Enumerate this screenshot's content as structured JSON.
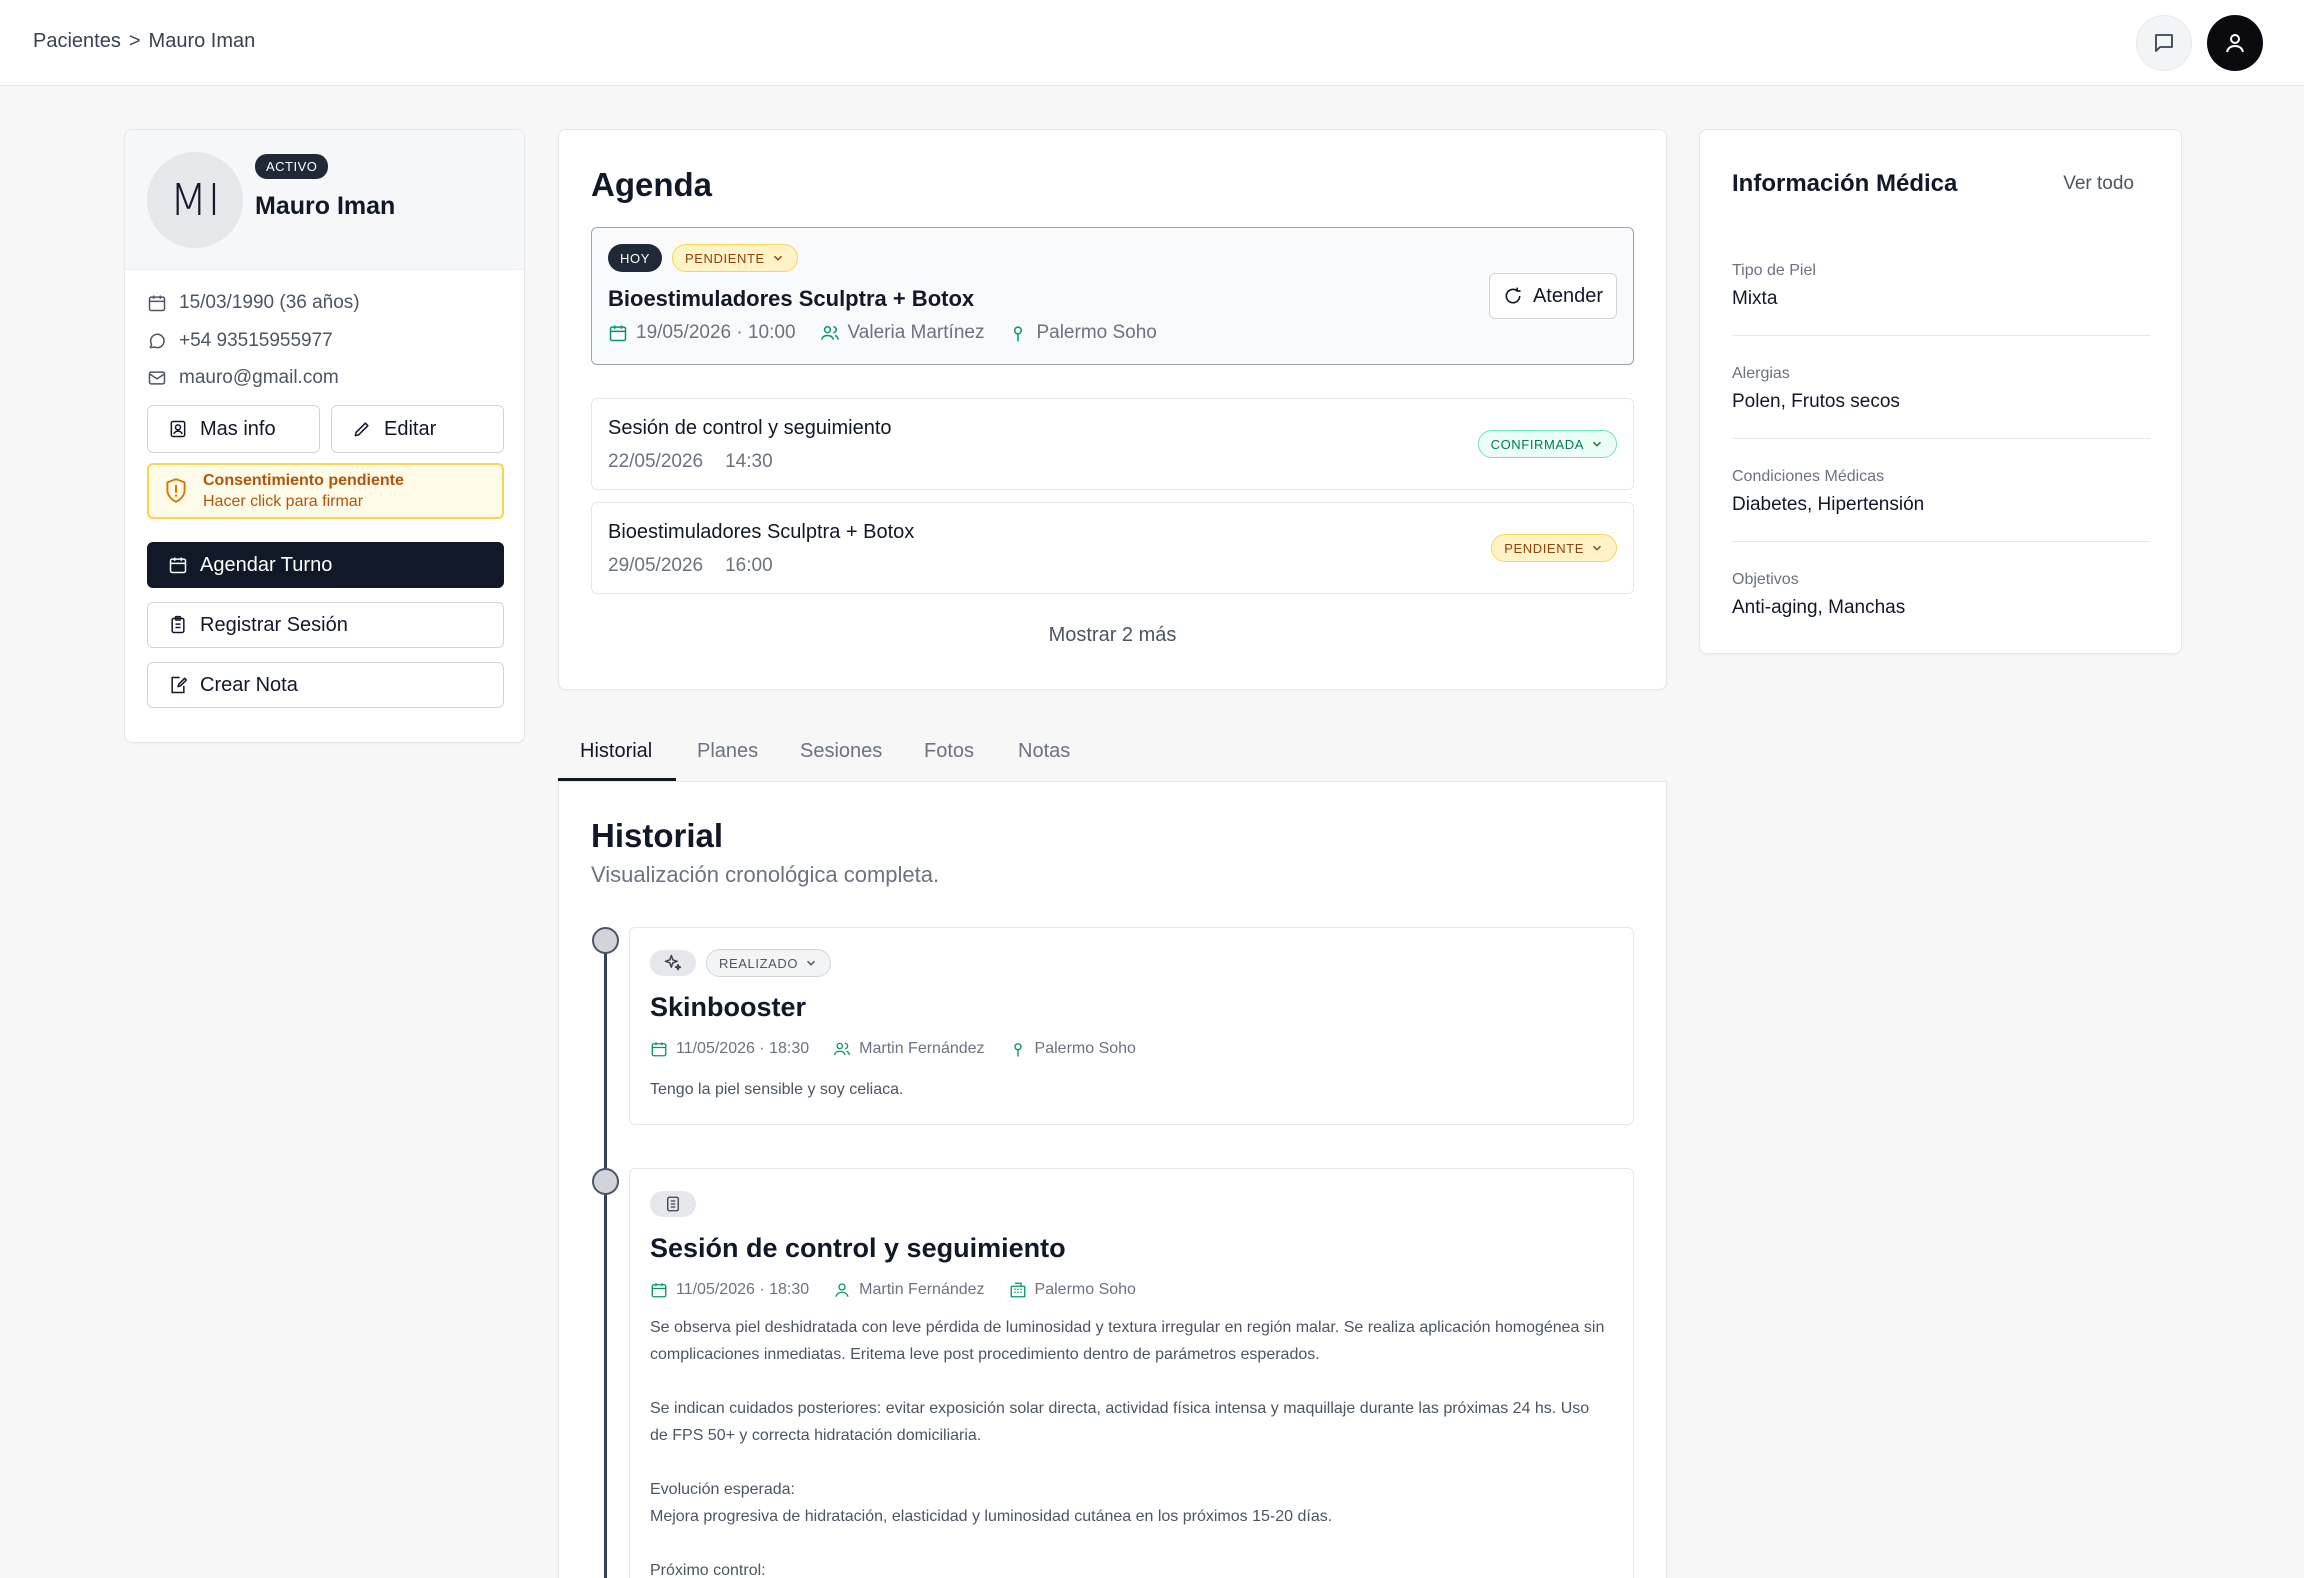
{
  "breadcrumb": {
    "root": "Pacientes",
    "separator": ">",
    "current": "Mauro Iman"
  },
  "patient": {
    "initials": "MI",
    "status": "ACTIVO",
    "name": "Mauro Iman",
    "birth": "15/03/1990 (36 años)",
    "phone": "+54 93515955977",
    "email": "mauro@gmail.com",
    "more_info_label": "Mas info",
    "edit_label": "Editar",
    "consent_title": "Consentimiento pendiente",
    "consent_sub": "Hacer click para firmar",
    "schedule_label": "Agendar Turno",
    "register_label": "Registrar Sesión",
    "note_label": "Crear Nota"
  },
  "agenda": {
    "title": "Agenda",
    "today": {
      "badge": "HOY",
      "status": "PENDIENTE",
      "title": "Bioestimuladores Sculptra + Botox",
      "datetime": "19/05/2026 · 10:00",
      "professional": "Valeria Martínez",
      "location": "Palermo Soho",
      "action_label": "Atender"
    },
    "upcoming": [
      {
        "title": "Sesión de control y seguimiento",
        "date": "22/05/2026",
        "time": "14:30",
        "status": "CONFIRMADA"
      },
      {
        "title": "Bioestimuladores Sculptra + Botox",
        "date": "29/05/2026",
        "time": "16:00",
        "status": "PENDIENTE"
      }
    ],
    "show_more": "Mostrar 2 más"
  },
  "medical": {
    "title": "Información Médica",
    "view_all": "Ver todo",
    "items": [
      {
        "label": "Tipo de Piel",
        "value": "Mixta"
      },
      {
        "label": "Alergias",
        "value": "Polen, Frutos secos"
      },
      {
        "label": "Condiciones Médicas",
        "value": "Diabetes, Hipertensión"
      },
      {
        "label": "Objetivos",
        "value": "Anti-aging, Manchas"
      }
    ]
  },
  "tabs": [
    "Historial",
    "Planes",
    "Sesiones",
    "Fotos",
    "Notas"
  ],
  "history": {
    "title": "Historial",
    "subtitle": "Visualización cronológica completa.",
    "entries": [
      {
        "status": "REALIZADO",
        "title": "Skinbooster",
        "datetime": "11/05/2026 · 18:30",
        "professional": "Martin Fernández",
        "location": "Palermo Soho",
        "note": "Tengo la piel sensible y soy celiaca."
      },
      {
        "title": "Sesión de control y seguimiento",
        "datetime": "11/05/2026 · 18:30",
        "professional": "Martin Fernández",
        "location": "Palermo Soho",
        "p1": "Se observa piel deshidratada con leve pérdida de luminosidad y textura irregular en región malar. Se realiza aplicación homogénea sin complicaciones inmediatas. Eritema leve post procedimiento dentro de parámetros esperados.",
        "p2": "Se indican cuidados posteriores: evitar exposición solar directa, actividad física intensa y maquillaje durante las próximas 24 hs. Uso de FPS 50+ y correcta hidratación domiciliaria.",
        "p3_title": "Evolución esperada:",
        "p3": "Mejora progresiva de hidratación, elasticidad y luminosidad cutánea en los próximos 15-20 días.",
        "p4_title": "Próximo control:"
      }
    ]
  },
  "colors": {
    "accent_green": "#059669",
    "dark": "#111827",
    "warning": "#b45309"
  }
}
